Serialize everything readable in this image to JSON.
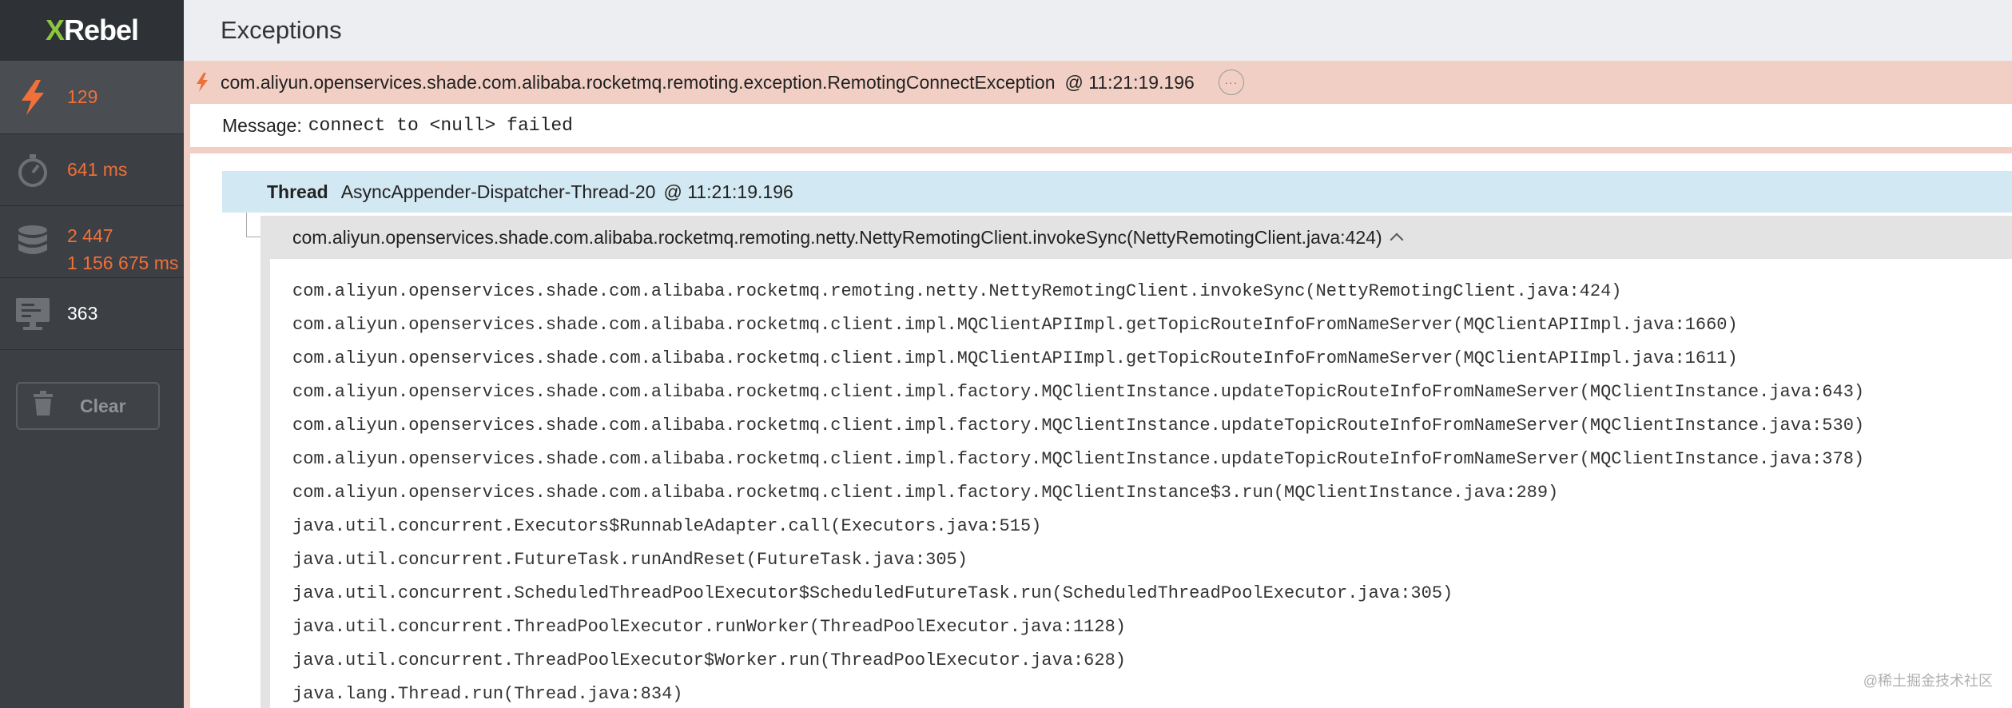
{
  "app": {
    "logo_x": "X",
    "logo_rest": "Rebel"
  },
  "sidebar": {
    "exceptions_count": "129",
    "time": "641 ms",
    "db_queries": "2 447",
    "db_time": "1 156 675 ms",
    "requests": "363",
    "clear_label": "Clear"
  },
  "header": {
    "title": "Exceptions"
  },
  "exception": {
    "class_name": "com.aliyun.openservices.shade.com.alibaba.rocketmq.remoting.exception.RemotingConnectException",
    "timestamp": "@ 11:21:19.196",
    "message_label": "Message:",
    "message_value": "connect to <null> failed"
  },
  "thread": {
    "label": "Thread",
    "name": "AsyncAppender-Dispatcher-Thread-20",
    "timestamp": "@ 11:21:19.196"
  },
  "frame": {
    "top": "com.aliyun.openservices.shade.com.alibaba.rocketmq.remoting.netty.NettyRemotingClient.invokeSync(NettyRemotingClient.java:424)"
  },
  "stack": [
    "com.aliyun.openservices.shade.com.alibaba.rocketmq.remoting.netty.NettyRemotingClient.invokeSync(NettyRemotingClient.java:424)",
    "com.aliyun.openservices.shade.com.alibaba.rocketmq.client.impl.MQClientAPIImpl.getTopicRouteInfoFromNameServer(MQClientAPIImpl.java:1660)",
    "com.aliyun.openservices.shade.com.alibaba.rocketmq.client.impl.MQClientAPIImpl.getTopicRouteInfoFromNameServer(MQClientAPIImpl.java:1611)",
    "com.aliyun.openservices.shade.com.alibaba.rocketmq.client.impl.factory.MQClientInstance.updateTopicRouteInfoFromNameServer(MQClientInstance.java:643)",
    "com.aliyun.openservices.shade.com.alibaba.rocketmq.client.impl.factory.MQClientInstance.updateTopicRouteInfoFromNameServer(MQClientInstance.java:530)",
    "com.aliyun.openservices.shade.com.alibaba.rocketmq.client.impl.factory.MQClientInstance.updateTopicRouteInfoFromNameServer(MQClientInstance.java:378)",
    "com.aliyun.openservices.shade.com.alibaba.rocketmq.client.impl.factory.MQClientInstance$3.run(MQClientInstance.java:289)",
    "java.util.concurrent.Executors$RunnableAdapter.call(Executors.java:515)",
    "java.util.concurrent.FutureTask.runAndReset(FutureTask.java:305)",
    "java.util.concurrent.ScheduledThreadPoolExecutor$ScheduledFutureTask.run(ScheduledThreadPoolExecutor.java:305)",
    "java.util.concurrent.ThreadPoolExecutor.runWorker(ThreadPoolExecutor.java:1128)",
    "java.util.concurrent.ThreadPoolExecutor$Worker.run(ThreadPoolExecutor.java:628)",
    "java.lang.Thread.run(Thread.java:834)"
  ],
  "watermark": "@稀土掘金技术社区",
  "colors": {
    "accent": "#f0703a",
    "exception_bg": "#f2cfc4",
    "thread_bg": "#d2e8f2",
    "logo_x": "#8cc63f"
  }
}
